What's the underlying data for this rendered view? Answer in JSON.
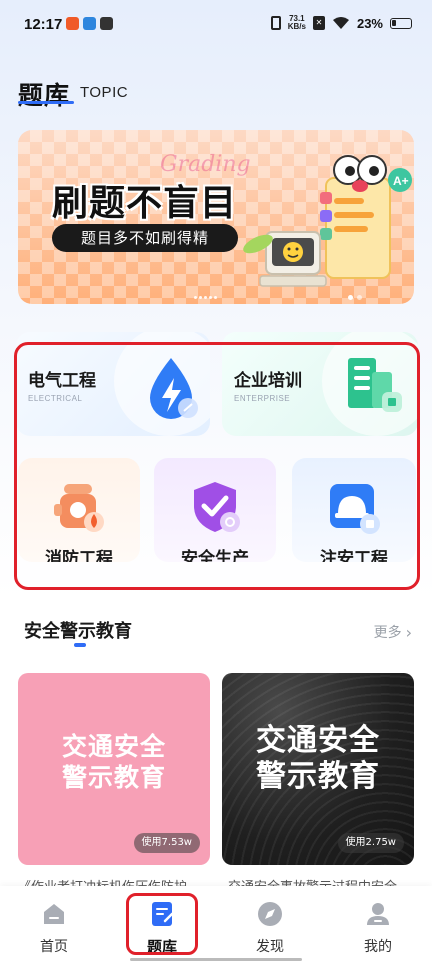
{
  "status_bar": {
    "time": "12:17",
    "net_speed_value": "73.1",
    "net_speed_unit": "KB/s",
    "battery": "23%"
  },
  "header": {
    "title": "题库",
    "subtitle": "TOPIC"
  },
  "banner": {
    "script_text": "Grading",
    "headline": "刷题不盲目",
    "pill_text": "题目多不如刷得精"
  },
  "categories": [
    {
      "title": "电气工程",
      "subtitle": "ELECTRICAL"
    },
    {
      "title": "企业培训",
      "subtitle": "ENTERPRISE"
    },
    {
      "title": "消防工程"
    },
    {
      "title": "安全生产"
    },
    {
      "title": "注安工程"
    }
  ],
  "section": {
    "title": "安全警示教育",
    "more_label": "更多"
  },
  "courses": [
    {
      "title_line1": "交通安全",
      "title_line2": "警示教育",
      "usage": "使用7.53w",
      "caption": "《作业者打冲标机伤压伤防护"
    },
    {
      "title_line1": "交通安全",
      "title_line2": "警示教育",
      "usage": "使用2.75w",
      "caption": "交通安全事故警示过程中安全"
    }
  ],
  "tabs": [
    {
      "label": "首页",
      "icon": "home-icon"
    },
    {
      "label": "题库",
      "icon": "question-bank-icon",
      "active": true
    },
    {
      "label": "发现",
      "icon": "compass-icon"
    },
    {
      "label": "我的",
      "icon": "profile-icon"
    }
  ],
  "colors": {
    "accent": "#2f6cf6",
    "highlight": "#e0202a"
  }
}
